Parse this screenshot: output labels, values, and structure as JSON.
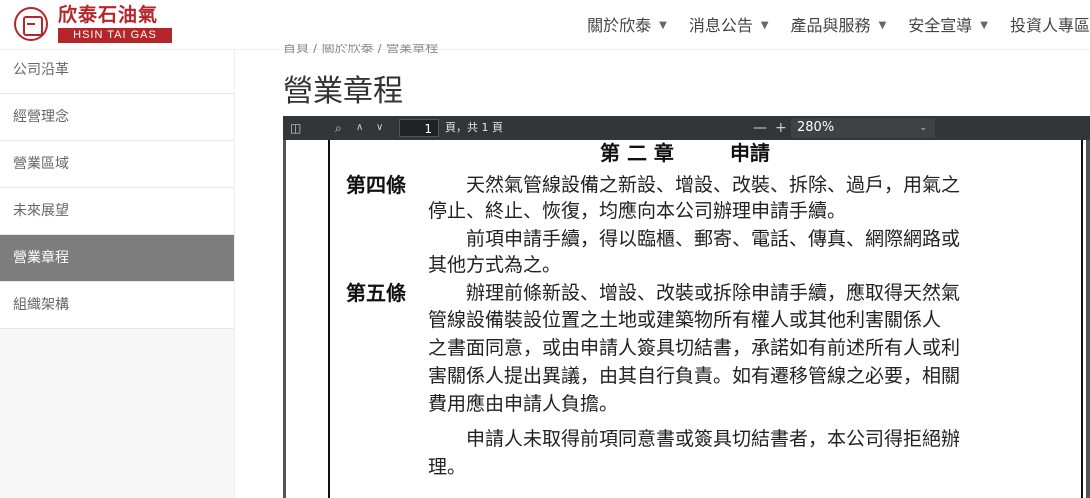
{
  "header": {
    "logo_cn": "欣泰石油氣",
    "logo_en": "HSIN TAI GAS",
    "nav": [
      {
        "label": "關於欣泰"
      },
      {
        "label": "消息公告"
      },
      {
        "label": "產品與服務"
      },
      {
        "label": "安全宣導"
      },
      {
        "label": "投資人專區"
      }
    ]
  },
  "sidebar": {
    "items": [
      {
        "label": "公司沿革"
      },
      {
        "label": "經營理念"
      },
      {
        "label": "營業區域"
      },
      {
        "label": "未來展望"
      },
      {
        "label": "營業章程",
        "active": true
      },
      {
        "label": "組織架構"
      }
    ]
  },
  "main": {
    "breadcrumb": "首頁 / 關於欣泰 / 營業章程",
    "title": "營業章程"
  },
  "viewer": {
    "page_current": "1",
    "page_total": "頁，共 1 頁",
    "zoom": "280%",
    "zoom_minus": "—",
    "zoom_plus": "+"
  },
  "document": {
    "chapter_no": "第 二 章",
    "chapter_title": "申請",
    "articles": [
      {
        "label": "第四條",
        "lines": [
          "天然氣管線設備之新設、增設、改裝、拆除、過戶，用氣之",
          "停止、終止、恢復，均應向本公司辦理申請手續。",
          "前項申請手續，得以臨櫃、郵寄、電話、傳真、網際網路或",
          "其他方式為之。"
        ]
      },
      {
        "label": "第五條",
        "lines": [
          "辦理前條新設、增設、改裝或拆除申請手續，應取得天然氣",
          "管線設備裝設位置之土地或建築物所有權人或其他利害關係人",
          "之書面同意，或由申請人簽具切結書，承諾如有前述所有人或利",
          "害關係人提出異議，由其自行負責。如有遷移管線之必要，相關",
          "費用應由申請人負擔。",
          "申請人未取得前項同意書或簽具切結書者，本公司得拒絕辦",
          "理。"
        ]
      }
    ]
  },
  "colors": {
    "brand": "#b5262b",
    "sidebar_active": "#7d7d7d",
    "toolbar": "#323639"
  }
}
